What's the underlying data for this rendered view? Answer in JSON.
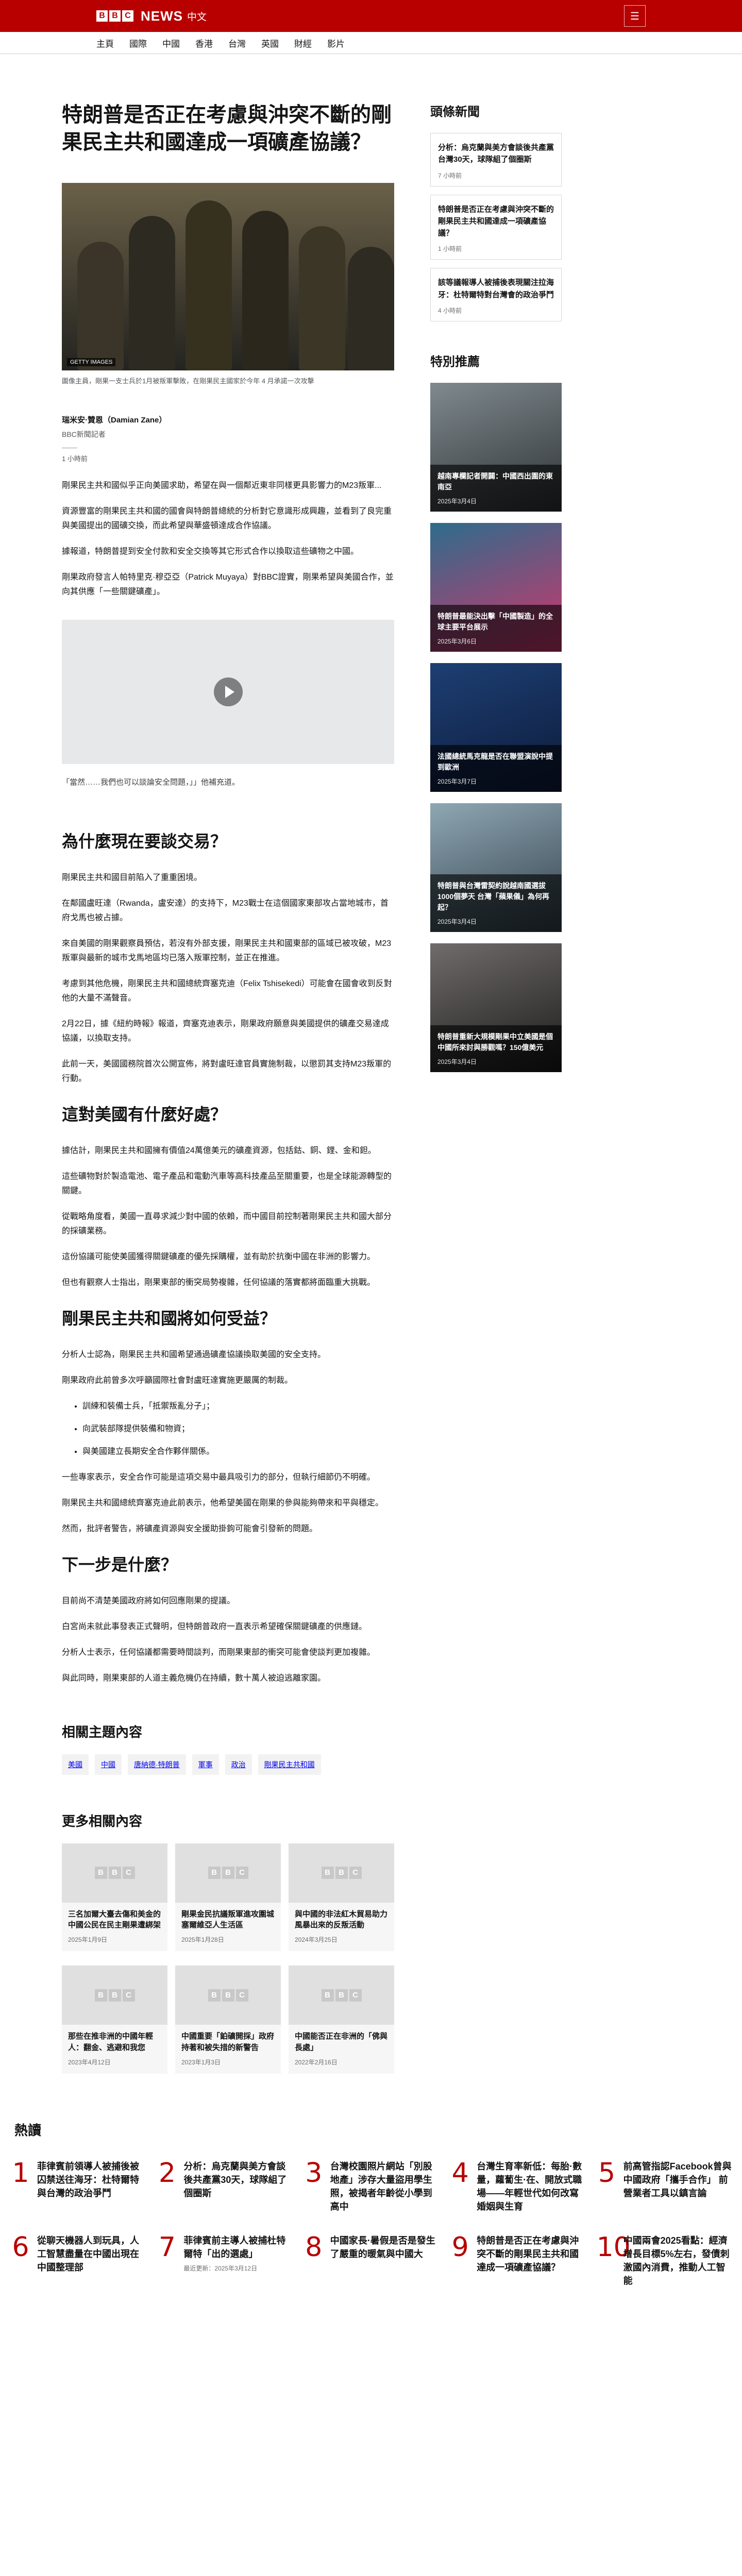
{
  "brand": {
    "news": "NEWS",
    "lang": "中文"
  },
  "menu_label": "☰",
  "nav": [
    "主頁",
    "國際",
    "中國",
    "香港",
    "台灣",
    "英國",
    "財經",
    "影片"
  ],
  "article": {
    "headline": "特朗普是否正在考慮與沖突不斷的剛果民主共和國達成一項礦產協議？",
    "image_credit": "GETTY IMAGES",
    "caption": "圖像主員，剛果一支士兵於1月被叛軍擊敗，在剛果民主國家於今年 4 月承諾一次攻擊",
    "author_name": "瑞米安·贊恩（Damian Zane）",
    "author_role": "BBC新聞記者",
    "time": "1 小時前",
    "paras1": [
      "剛果民主共和國似乎正向美國求助，希望在與一個鄰近東非同樣更具影響力的M23叛軍...",
      "資源豐富的剛果民主共和國的國會與特朗普總統的分析對它意識形成興趣，並看到了良完重與美國提出的國礦交換，而此希望與華盛頓達成合作協議。",
      "據報道，特朗普提到安全付款和安全交換等其它形式合作以換取這些礦物之中國。",
      "剛果政府發言人帕特里克·穆亞亞（Patrick Muyaya）對BBC證實，剛果希望與美國合作，並向其供應「一些關鍵礦產」。"
    ],
    "video_caption": "「當然……我們也可以談論安全問題，」」他補充道。",
    "h2_1": "為什麼現在要談交易？",
    "paras2": [
      "剛果民主共和國目前陷入了重重困境。",
      "在鄰國盧旺達（Rwanda，盧安達）的支持下，M23戰士在這個國家東部攻占當地城市，首府戈馬也被占據。",
      "來自美國的剛果觀察員預估，若沒有外部支援，剛果民主共和國東部的區域已被攻破，M23叛軍與最新的城市戈馬地區均已落入叛軍控制，並正在推進。",
      "考慮到其他危機，剛果民主共和國總統齊塞克迪（Felix Tshisekedi）可能會在國會收到反對他的大量不滿聲音。",
      "2月22日，據《紐約時報》報道，齊塞克迪表示，剛果政府願意與美國提供的礦產交易達成協議，以換取支持。",
      "此前一天，美國國務院首次公開宣佈，將對盧旺達官員實施制裁，以懲罰其支持M23叛軍的行動。"
    ],
    "h2_2": "這對美國有什麼好處？",
    "paras3": [
      "據估計，剛果民主共和國擁有價值24萬億美元的礦產資源，包括鈷、銅、鋰、金和鉭。",
      "這些礦物對於製造電池、電子產品和電動汽車等高科技產品至關重要，也是全球能源轉型的關鍵。",
      "從戰略角度看，美國一直尋求減少對中國的依賴，而中國目前控制著剛果民主共和國大部分的採礦業務。",
      "這份協議可能使美國獲得關鍵礦產的優先採購權，並有助於抗衡中國在非洲的影響力。",
      "但也有觀察人士指出，剛果東部的衝突局勢複雜，任何協議的落實都將面臨重大挑戰。"
    ],
    "h2_3": "剛果民主共和國將如何受益？",
    "paras4": [
      "分析人士認為，剛果民主共和國希望通過礦產協議換取美國的安全支持。",
      "剛果政府此前曾多次呼籲國際社會對盧旺達實施更嚴厲的制裁。"
    ],
    "bullets": [
      "訓練和裝備士兵，「抵禦叛亂分子」；",
      "向武裝部隊提供裝備和物資；",
      "與美國建立長期安全合作夥伴關係。"
    ],
    "paras5": [
      "一些專家表示，安全合作可能是這項交易中最具吸引力的部分，但執行細節仍不明確。",
      "剛果民主共和國總統齊塞克迪此前表示，他希望美國在剛果的參與能夠帶來和平與穩定。",
      "然而，批評者警告，將礦產資源與安全援助掛鉤可能會引發新的問題。"
    ],
    "h2_4": "下一步是什麼？",
    "paras6": [
      "目前尚不清楚美國政府將如何回應剛果的提議。",
      "白宮尚未就此事發表正式聲明，但特朗普政府一直表示希望確保關鍵礦產的供應鏈。",
      "分析人士表示，任何協議都需要時間談判，而剛果東部的衝突可能會使談判更加複雜。",
      "與此同時，剛果東部的人道主義危機仍在持續，數十萬人被迫逃離家園。"
    ]
  },
  "topics_title": "相關主題內容",
  "topics": [
    "美國",
    "中國",
    "唐納德·特朗普",
    "軍事",
    "政治",
    "剛果民主共和國"
  ],
  "related_title": "更多相關內容",
  "related": [
    {
      "title": "三名加爾大臺去傷和美金的中國公民在民主剛果遭綁架",
      "date": "2025年1月9日"
    },
    {
      "title": "剛果金民抗議叛軍進攻圍城塞爾維亞人生活區",
      "date": "2025年1月28日"
    },
    {
      "title": "與中國的非法紅木貿易助力風暴出來的反叛活動",
      "date": "2024年3月25日"
    },
    {
      "title": "那些在推非洲的中國年輕人：翻金、逃避和我您",
      "date": "2023年4月12日"
    },
    {
      "title": "中國重要「鉑礦開採」政府持著和被失措的新警告",
      "date": "2023年1月3日"
    },
    {
      "title": "中國能否正在非洲的「佛與長處」",
      "date": "2022年2月16日"
    }
  ],
  "aside": {
    "headlines_title": "頭條新聞",
    "headlines": [
      {
        "title": "分析：烏克蘭與美方會談後共產黨台灣30天，球隊組了個圈斯",
        "time": "7 小時前"
      },
      {
        "title": "特朗普是否正在考慮與沖突不斷的剛果民主共和國達成一項礦產協議？",
        "time": "1 小時前"
      },
      {
        "title": "該等議報導人被捕後表現關注拉海牙：杜特爾特對台灣會的政治爭鬥",
        "time": "4 小時前"
      }
    ],
    "featured_title": "特別推薦",
    "featured": [
      {
        "title": "越南專欄記者開闢：中國西出圍的東南亞",
        "date": "2025年3月4日",
        "c1": "#7f8a8f",
        "c2": "#2e3234"
      },
      {
        "title": "特朗普最能決出擊「中國製造」的全球主要平台展示",
        "date": "2025年3月6日",
        "c1": "#2d6c8c",
        "c2": "#d1356b"
      },
      {
        "title": "法國總統馬克龍是否在聯盟演說中提到歐洲",
        "date": "2025年3月7日",
        "c1": "#1d3f73",
        "c2": "#0d1b3a"
      },
      {
        "title": "特朗普與台灣雷契約說越南國選拔1000個夢天 台灣「蘋果儀」為何再起？",
        "date": "2025年3月4日",
        "c1": "#8fa7b4",
        "c2": "#31404a"
      },
      {
        "title": "特朗普重新大規模剛果中立美國是個中國所來討與勝觀嗎？150億美元",
        "date": "2025年3月4日",
        "c1": "#6f6c6a",
        "c2": "#1b1a1a"
      }
    ]
  },
  "most_read": {
    "title": "熱讀",
    "items": [
      {
        "num": "1",
        "title": "菲律賓前領導人被捕後被囚禁送往海牙：杜特爾特與台灣的政治爭鬥",
        "meta": ""
      },
      {
        "num": "2",
        "title": "分析：烏克蘭與美方會談後共產黨30天，球隊組了個圈斯",
        "meta": ""
      },
      {
        "num": "3",
        "title": "台灣校園照片網站「別股地產」涉存大量盜用學生照，被揭者年齡從小學到高中",
        "meta": ""
      },
      {
        "num": "4",
        "title": "台灣生育率新低：每胎·數量，蘿蔔生·在、開放式職場——年輕世代如何改寫婚姻與生育",
        "meta": ""
      },
      {
        "num": "5",
        "title": "前高管指認Facebook曾與中國政府「攜手合作」 前營業者工具以鎮言論",
        "meta": ""
      },
      {
        "num": "6",
        "title": "從聊天機器人到玩具，人工智慧盡量在中國出現在中國整理部",
        "meta": ""
      },
      {
        "num": "7",
        "title": "菲律賓前主導人被捕杜特爾特「出的選處」",
        "meta": "最近更新：2025年3月12日"
      },
      {
        "num": "8",
        "title": "中國家長·暑假是否是發生了嚴重的暖氣與中國大",
        "meta": ""
      },
      {
        "num": "9",
        "title": "特朗普是否正在考慮與沖突不斷的剛果民主共和國達成一項礦產協議？",
        "meta": ""
      },
      {
        "num": "10",
        "title": "中國兩會2025看點：經濟增長目標5%左右，發債刺激國內消費，推動人工智能",
        "meta": ""
      }
    ]
  }
}
